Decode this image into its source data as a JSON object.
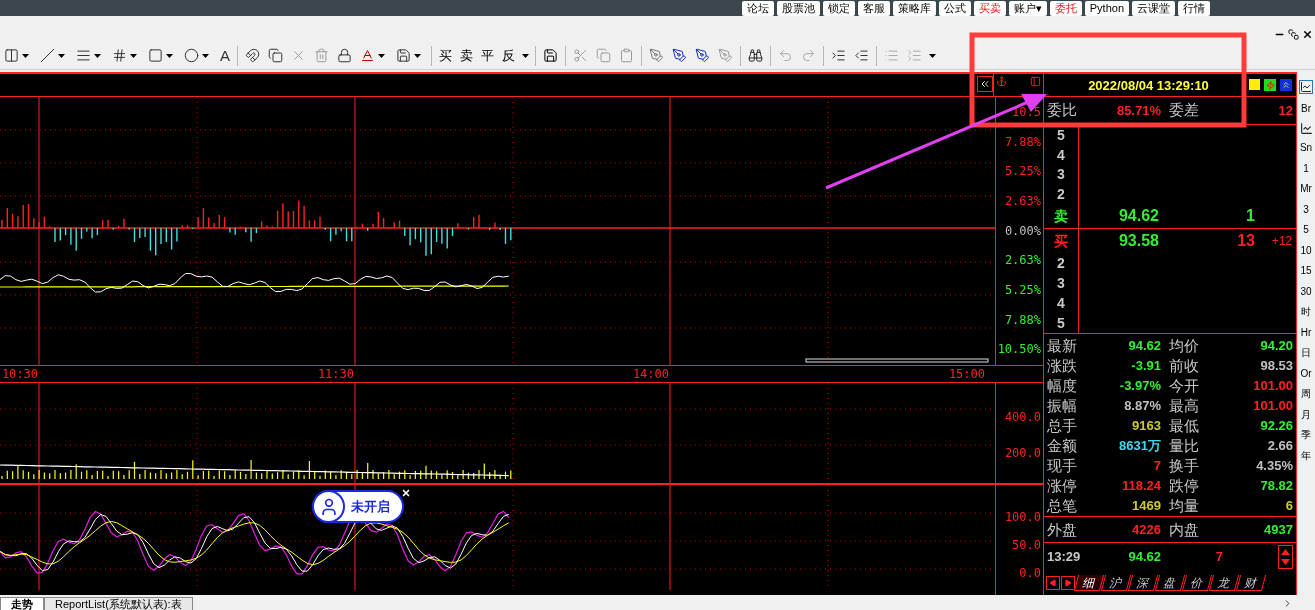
{
  "top_menu": [
    {
      "label": "论坛",
      "highlighted": false
    },
    {
      "label": "股票池",
      "highlighted": false
    },
    {
      "label": "锁定",
      "highlighted": false
    },
    {
      "label": "客服",
      "highlighted": false
    },
    {
      "label": "策略库",
      "highlighted": false
    },
    {
      "label": "公式",
      "highlighted": false
    },
    {
      "label": "买卖",
      "highlighted": true
    },
    {
      "label": "账户▾",
      "highlighted": false
    },
    {
      "label": "委托",
      "highlighted": true
    },
    {
      "label": "Python",
      "highlighted": false
    },
    {
      "label": "云课堂",
      "highlighted": false
    },
    {
      "label": "行情",
      "highlighted": false
    }
  ],
  "toolbar": {
    "text_tool": "A",
    "trade_buttons": [
      "买",
      "卖",
      "平",
      "反"
    ]
  },
  "chart": {
    "price_axis": [
      {
        "label": "10.5",
        "color": "#ff2020"
      },
      {
        "label": "7.88%",
        "color": "#ff2020"
      },
      {
        "label": "5.25%",
        "color": "#ff2020"
      },
      {
        "label": "2.63%",
        "color": "#ff2020"
      },
      {
        "label": "0.00%",
        "color": "#c0c0c0"
      },
      {
        "label": "2.63%",
        "color": "#33ee33"
      },
      {
        "label": "5.25%",
        "color": "#33ee33"
      },
      {
        "label": "7.88%",
        "color": "#33ee33"
      },
      {
        "label": "10.50%",
        "color": "#33ee33"
      }
    ],
    "time_axis": [
      "10:30",
      "11:30",
      "14:00",
      "15:00"
    ],
    "volume_axis": [
      "400.0",
      "200.0"
    ],
    "indicator_axis": [
      "100.0",
      "50.0",
      "0.0"
    ],
    "popup": {
      "label": "未开启"
    }
  },
  "quote": {
    "datetime": "2022/08/04 13:29:10",
    "ratio": {
      "label": "委比",
      "value": "85.71%",
      "diff_label": "委差",
      "diff_value": "12"
    },
    "asks": [
      {
        "label": "5"
      },
      {
        "label": "4"
      },
      {
        "label": "3"
      },
      {
        "label": "2"
      },
      {
        "label": "卖",
        "price": "94.62",
        "volume": "1"
      }
    ],
    "bids": [
      {
        "label": "买",
        "price": "93.58",
        "volume": "13",
        "change": "+12"
      },
      {
        "label": "2"
      },
      {
        "label": "3"
      },
      {
        "label": "4"
      },
      {
        "label": "5"
      }
    ],
    "stats": [
      {
        "left": {
          "label": "最新",
          "value": "94.62",
          "color": "#33ee33"
        },
        "right": {
          "label": "均价",
          "value": "94.20",
          "color": "#33ee33"
        }
      },
      {
        "left": {
          "label": "涨跌",
          "value": "-3.91",
          "color": "#33ee33"
        },
        "right": {
          "label": "前收",
          "value": "98.53",
          "color": "#c0c0c0"
        }
      },
      {
        "left": {
          "label": "幅度",
          "value": "-3.97%",
          "color": "#33ee33"
        },
        "right": {
          "label": "今开",
          "value": "101.00",
          "color": "#ff2020"
        }
      },
      {
        "left": {
          "label": "振幅",
          "value": "8.87%",
          "color": "#c0c0c0"
        },
        "right": {
          "label": "最高",
          "value": "101.00",
          "color": "#ff2020"
        }
      },
      {
        "left": {
          "label": "总手",
          "value": "9163",
          "color": "#d0c830"
        },
        "right": {
          "label": "最低",
          "value": "92.26",
          "color": "#33ee33"
        }
      },
      {
        "left": {
          "label": "金额",
          "value": "8631万",
          "color": "#40d8f0"
        },
        "right": {
          "label": "量比",
          "value": "2.66",
          "color": "#c0c0c0"
        }
      },
      {
        "left": {
          "label": "现手",
          "value": "7",
          "color": "#ff2020"
        },
        "right": {
          "label": "换手",
          "value": "4.35%",
          "color": "#c0c0c0"
        }
      },
      {
        "left": {
          "label": "涨停",
          "value": "118.24",
          "color": "#ff2020"
        },
        "right": {
          "label": "跌停",
          "value": "78.82",
          "color": "#33ee33"
        }
      },
      {
        "left": {
          "label": "总笔",
          "value": "1469",
          "color": "#d0c830"
        },
        "right": {
          "label": "均量",
          "value": "6",
          "color": "#d0c830"
        }
      }
    ],
    "trade_sides": [
      {
        "label": "外盘",
        "value": "4226",
        "color": "#ff2020"
      },
      {
        "label": "内盘",
        "value": "4937",
        "color": "#33ee33"
      }
    ],
    "last_tick": {
      "time": "13:29",
      "price": "94.62",
      "volume": "7"
    },
    "tabs": [
      {
        "label": "细",
        "selected": true
      },
      {
        "label": "沪",
        "selected": false
      },
      {
        "label": "深",
        "selected": false
      },
      {
        "label": "盘",
        "selected": false
      },
      {
        "label": "价",
        "selected": false
      },
      {
        "label": "龙",
        "selected": false
      },
      {
        "label": "财",
        "selected": false
      }
    ]
  },
  "period_sidebar": [
    "Br",
    "Sn",
    "1",
    "Mr",
    "3",
    "5",
    "10",
    "15",
    "30",
    "时",
    "Hr",
    "日",
    "Or",
    "周",
    "月",
    "季",
    "年"
  ],
  "bottom_tabs": [
    {
      "label": "走势",
      "selected": true
    },
    {
      "label": "ReportList(系统默认表):表",
      "selected": false
    }
  ]
}
